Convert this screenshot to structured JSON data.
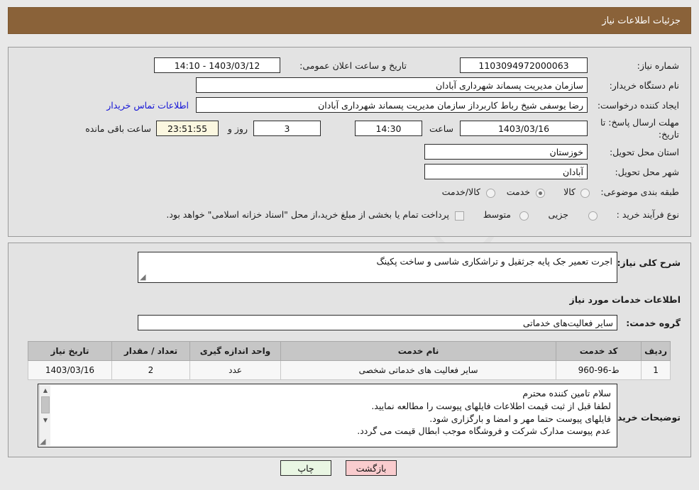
{
  "header": {
    "title": "جزئیات اطلاعات نیاز"
  },
  "watermark": {
    "text_left": "hria",
    "text_mid": "Tender",
    "text_right": ".net",
    "full": "AriaTender.net"
  },
  "form": {
    "need_number": {
      "label": "شماره نیاز:",
      "value": "1103094972000063"
    },
    "announce_datetime": {
      "label": "تاریخ و ساعت اعلان عمومی:",
      "value": "1403/03/12 - 14:10"
    },
    "buyer_org": {
      "label": "نام دستگاه خریدار:",
      "value": "سازمان مدیریت پسماند شهرداری آبادان"
    },
    "creator": {
      "label": "ایجاد کننده درخواست:",
      "value": "رضا یوسفی شیخ رباط کاربرداز سازمان مدیریت پسماند شهرداری آبادان"
    },
    "contact_link": {
      "label": "اطلاعات تماس خریدار"
    },
    "deadline": {
      "label": "مهلت ارسال پاسخ: تا تاریخ:",
      "date": "1403/03/16",
      "hour_label": "ساعت",
      "time": "14:30",
      "days": "3",
      "days_label": "روز و",
      "countdown": "23:51:55",
      "remaining_label": "ساعت باقی مانده"
    },
    "province": {
      "label": "استان محل تحویل:",
      "value": "خوزستان"
    },
    "city": {
      "label": "شهر محل تحویل:",
      "value": "آبادان"
    },
    "category": {
      "label": "طبقه بندی موضوعی:",
      "options": [
        "کالا",
        "خدمت",
        "کالا/خدمت"
      ],
      "selected": "خدمت"
    },
    "purchase_process": {
      "label": "نوع فرآیند خرید :",
      "options": [
        "جزیی",
        "متوسط"
      ],
      "selected": "",
      "checkbox_label": "پرداخت تمام یا بخشی از مبلغ خرید،از محل \"اسناد خزانه اسلامی\" خواهد بود.",
      "checkbox_checked": false
    }
  },
  "details": {
    "general_desc": {
      "label": "شرح کلی نیاز:",
      "value": "اجرت تعمیر جک پایه جرثقیل و تراشکاری شاسی و ساخت پکینگ"
    },
    "section_title": "اطلاعات خدمات مورد نیاز",
    "service_group": {
      "label": "گروه خدمت:",
      "value": "سایر فعالیت‌های خدماتی"
    },
    "table": {
      "headers": [
        "ردیف",
        "کد خدمت",
        "نام خدمت",
        "واحد اندازه گیری",
        "تعداد / مقدار",
        "تاریخ نیاز"
      ],
      "rows": [
        [
          "1",
          "ط-96-960",
          "سایر فعالیت های خدماتی شخصی",
          "عدد",
          "2",
          "1403/03/16"
        ]
      ]
    },
    "buyer_notes": {
      "label": "توضیحات خریدار:",
      "lines": [
        "سلام تامین کننده محترم",
        "لطفا قبل از ثبت قیمت اطلاعات فایلهای پیوست را مطالعه نمایید.",
        "فایلهای پیوست حتما مهر و امضا و بارگزاری شود.",
        "عدم پیوست مدارک شرکت و فروشگاه موجب ابطال قیمت می گردد."
      ]
    }
  },
  "footer": {
    "print_label": "چاپ",
    "back_label": "بازگشت"
  },
  "colors": {
    "banner": "#8a6239",
    "link": "#1414d6",
    "countdown_bg": "#fbf7e0",
    "print_bg": "#e9f6e3",
    "back_bg": "#f9ccce"
  }
}
